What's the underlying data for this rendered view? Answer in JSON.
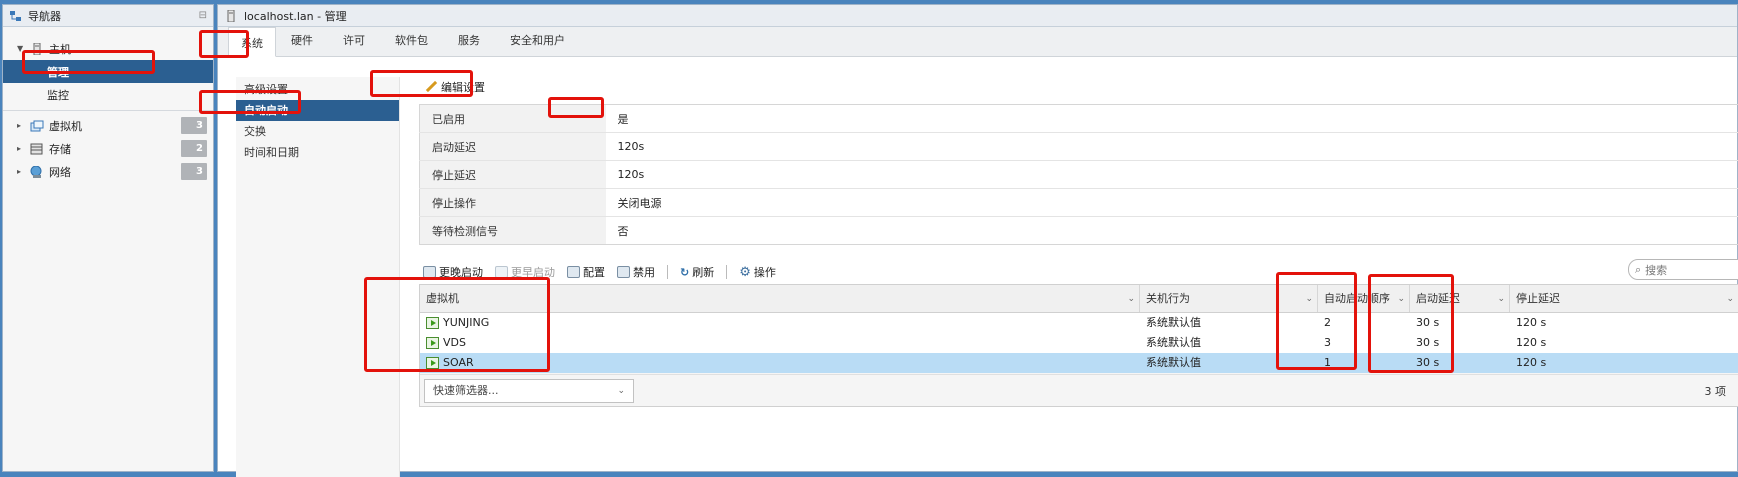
{
  "navigator": {
    "title": "导航器",
    "host_label": "主机",
    "manage_label": "管理",
    "monitor_label": "监控",
    "items": [
      {
        "label": "虚拟机",
        "count": "3"
      },
      {
        "label": "存储",
        "count": "2"
      },
      {
        "label": "网络",
        "count": "3"
      }
    ]
  },
  "window": {
    "title": "localhost.lan - 管理"
  },
  "tabs": [
    "系统",
    "硬件",
    "许可",
    "软件包",
    "服务",
    "安全和用户"
  ],
  "side_menu": [
    "高级设置",
    "自动启动",
    "交换",
    "时间和日期"
  ],
  "edit_settings": "编辑设置",
  "settings": [
    {
      "key": "已启用",
      "value": "是"
    },
    {
      "key": "启动延迟",
      "value": "120s"
    },
    {
      "key": "停止延迟",
      "value": "120s"
    },
    {
      "key": "停止操作",
      "value": "关闭电源"
    },
    {
      "key": "等待检测信号",
      "value": "否"
    }
  ],
  "toolbar": {
    "later": "更晚启动",
    "earlier": "更早启动",
    "configure": "配置",
    "disable": "禁用",
    "refresh": "刷新",
    "actions": "操作",
    "search_placeholder": "搜索"
  },
  "grid": {
    "columns": [
      "虚拟机",
      "关机行为",
      "自动启动顺序",
      "启动延迟",
      "停止延迟"
    ],
    "rows": [
      {
        "name": "YUNJING",
        "shutdown": "系统默认值",
        "order": "2",
        "start_delay": "30 s",
        "stop_delay": "120 s"
      },
      {
        "name": "VDS",
        "shutdown": "系统默认值",
        "order": "3",
        "start_delay": "30 s",
        "stop_delay": "120 s"
      },
      {
        "name": "SOAR",
        "shutdown": "系统默认值",
        "order": "1",
        "start_delay": "30 s",
        "stop_delay": "120 s"
      }
    ],
    "quick_filter": "快速筛选器...",
    "item_count": "3 项"
  }
}
